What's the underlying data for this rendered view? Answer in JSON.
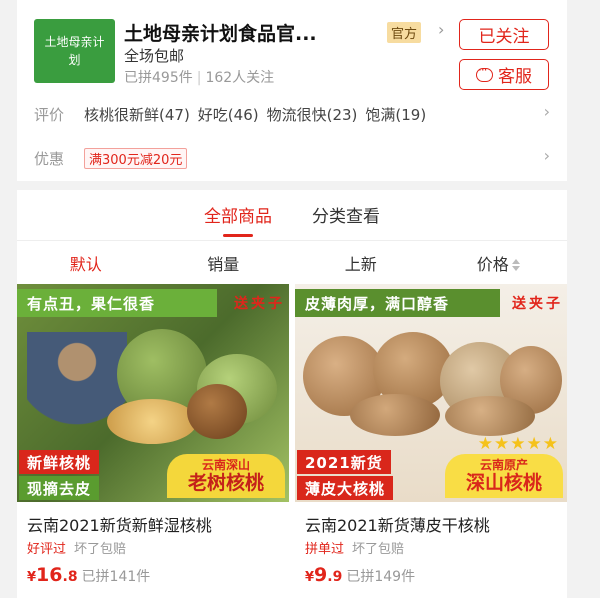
{
  "store": {
    "logo_text": "土地母亲计划",
    "name": "土地母亲计划食品官...",
    "official_badge": "官方",
    "shipping": "全场包邮",
    "sold_count": "已拼495件",
    "followers": "162人关注",
    "follow_button": "已关注",
    "service_button": "客服"
  },
  "reviews": {
    "label": "评价",
    "tags": [
      "核桃很新鲜(47)",
      "好吃(46)",
      "物流很快(23)",
      "饱满(19)"
    ]
  },
  "promo": {
    "label": "优惠",
    "badge": "满300元减20元"
  },
  "main_tabs": [
    {
      "label": "全部商品",
      "active": true
    },
    {
      "label": "分类查看",
      "active": false
    }
  ],
  "sort_bar": [
    {
      "label": "默认",
      "active": true
    },
    {
      "label": "销量",
      "active": false
    },
    {
      "label": "上新",
      "active": false
    },
    {
      "label": "价格",
      "active": false
    }
  ],
  "products": [
    {
      "banner": "有点丑，果仁很香",
      "gift": "送夹子",
      "label_red": "新鲜核桃",
      "label_green": "现摘去皮",
      "origin_small": "云南深山",
      "origin_big": "老树核桃",
      "title": "云南2021新货新鲜湿核桃",
      "tag1": "好评过",
      "tag2": "坏了包赔",
      "price_yen": "¥",
      "price_int": "16",
      "price_dec": ".8",
      "sold": "已拼141件"
    },
    {
      "banner": "皮薄肉厚，满口醇香",
      "gift": "送夹子",
      "stars": "★★★★★",
      "label_red": "2021新货",
      "label_green": "薄皮大核桃",
      "origin_small": "云南原产",
      "origin_big": "深山核桃",
      "title": "云南2021新货薄皮干核桃",
      "tag1": "拼单过",
      "tag2": "坏了包赔",
      "price_yen": "¥",
      "price_int": "9",
      "price_dec": ".9",
      "sold": "已拼149件"
    }
  ],
  "colors": {
    "accent": "#e1251b",
    "logo_bg": "#3a9d3f"
  }
}
